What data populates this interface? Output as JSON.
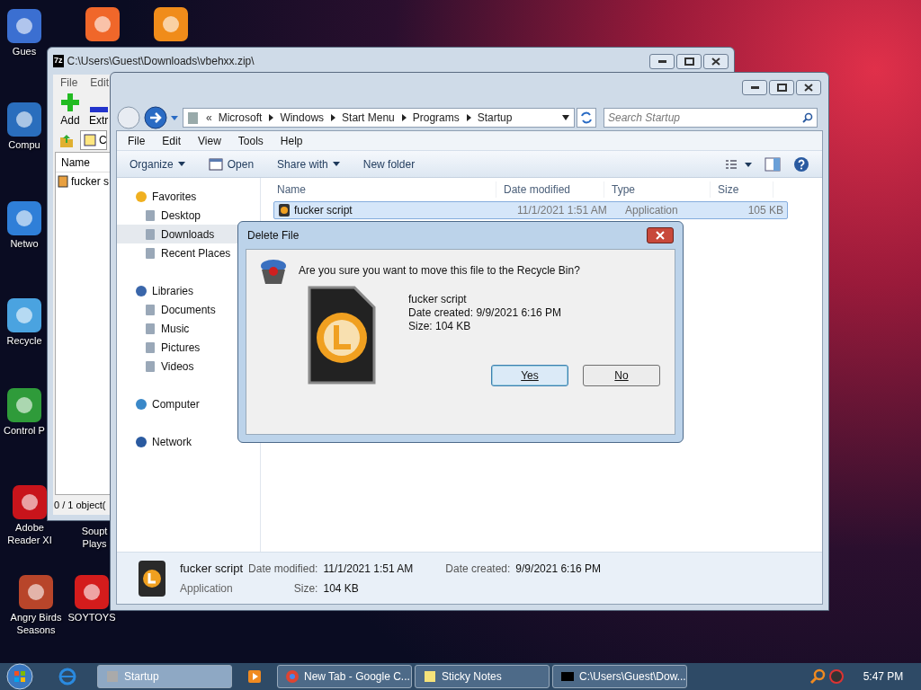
{
  "desktop_icons": [
    {
      "label": "Gues",
      "color": "#3b6fd1"
    },
    {
      "color": "#f0672a"
    },
    {
      "color": "#f08c1a"
    },
    {
      "label": "Compu",
      "color": "#2a6ebd"
    },
    {
      "label": "Netwo",
      "color": "#2f7fd8"
    },
    {
      "label": "Recycle",
      "color": "#4aa3e0"
    },
    {
      "label": "Control P",
      "color": "#2f9b3a"
    },
    {
      "label": "Adobe Reader XI",
      "color": "#c8141b"
    },
    {
      "label": "Soupt Plays"
    },
    {
      "label": "Angry Birds Seasons",
      "color": "#b8452a"
    },
    {
      "label": "SOYTOYS",
      "color": "#d41c1c"
    }
  ],
  "zip_window": {
    "logo": "7z",
    "title": "C:\\Users\\Guest\\Downloads\\vbehxx.zip\\",
    "menu": [
      "File",
      "Edit"
    ],
    "toolbar": [
      "Add",
      "Extr"
    ],
    "address": "C",
    "column": "Name",
    "row": "fucker s",
    "status": "0 / 1 object("
  },
  "explorer": {
    "breadcrumb_overflow": "«",
    "breadcrumb": [
      "Microsoft",
      "Windows",
      "Start Menu",
      "Programs",
      "Startup"
    ],
    "search": {
      "placeholder": "Search Startup"
    },
    "menu": [
      "File",
      "Edit",
      "View",
      "Tools",
      "Help"
    ],
    "toolbar": [
      {
        "label": "Organize",
        "kind": "dropdown"
      },
      {
        "label": "Open",
        "kind": "icon"
      },
      {
        "label": "Share with",
        "kind": "dropdown"
      },
      {
        "label": "New folder",
        "kind": "plain"
      }
    ],
    "nav": [
      {
        "label": "Favorites",
        "children": [
          {
            "label": "Desktop",
            "selected": false
          },
          {
            "label": "Downloads",
            "selected": true
          },
          {
            "label": "Recent Places",
            "selected": false
          }
        ]
      },
      {
        "label": "Libraries",
        "children": [
          {
            "label": "Documents",
            "selected": false
          },
          {
            "label": "Music",
            "selected": false
          },
          {
            "label": "Pictures",
            "selected": false
          },
          {
            "label": "Videos",
            "selected": false
          }
        ]
      },
      {
        "label": "Computer"
      },
      {
        "label": "Network"
      }
    ],
    "columns": [
      "Name",
      "Date modified",
      "Type",
      "Size"
    ],
    "rows": [
      {
        "cells": [
          "fucker script",
          "11/1/2021 1:51 AM",
          "Application",
          "105 KB"
        ],
        "selected": true
      }
    ],
    "details": {
      "name": "fucker script",
      "type": "Application",
      "fields": [
        {
          "label": "Date modified:",
          "value": "11/1/2021 1:51 AM"
        },
        {
          "label": "Date created:",
          "value": "9/9/2021 6:16 PM"
        },
        {
          "label": "Size:",
          "value": "104 KB"
        }
      ]
    }
  },
  "dialog": {
    "title": "Delete File",
    "question": "Are you sure you want to move this file to the Recycle Bin?",
    "file_lines": [
      "fucker script",
      "Date created: 9/9/2021 6:16 PM",
      "Size: 104 KB"
    ],
    "buttons": [
      {
        "label": "Yes",
        "selected": true
      },
      {
        "label": "No",
        "selected": false
      }
    ]
  },
  "taskbar": {
    "items": [
      {
        "label": "Startup",
        "selected": true
      },
      {
        "label": "New Tab - Google C...",
        "selected": false
      },
      {
        "label": "Sticky Notes",
        "selected": false
      },
      {
        "label": "C:\\Users\\Guest\\Dow...",
        "selected": false
      }
    ],
    "clock": "5:47 PM"
  }
}
